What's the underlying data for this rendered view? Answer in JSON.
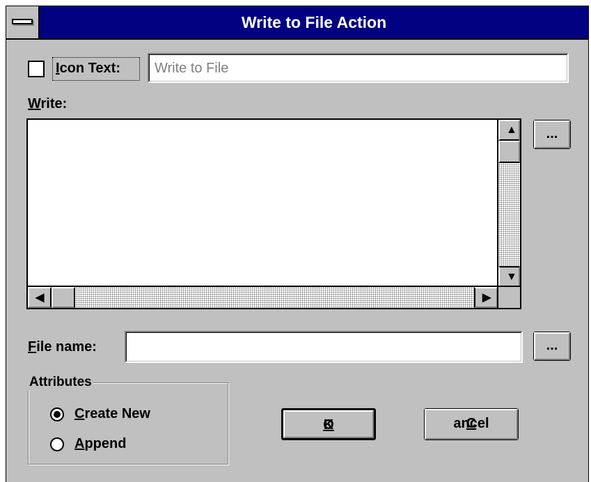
{
  "window": {
    "title": "Write to File Action"
  },
  "icon_text": {
    "label": "Icon Text:",
    "checked": false,
    "value": "Write to File"
  },
  "write": {
    "label": "Write:",
    "value": "",
    "browse_label": "..."
  },
  "file_name": {
    "label": "File name:",
    "value": "",
    "browse_label": "..."
  },
  "attributes": {
    "label": "Attributes",
    "options": [
      {
        "label": "Create New",
        "selected": true
      },
      {
        "label": "Append",
        "selected": false
      }
    ]
  },
  "buttons": {
    "ok": "OK",
    "cancel": "Cancel"
  },
  "icons": {
    "system_menu": "system-menu-icon",
    "scroll_up": "arrow-up-icon",
    "scroll_down": "arrow-down-icon",
    "scroll_left": "arrow-left-icon",
    "scroll_right": "arrow-right-icon"
  },
  "colors": {
    "titlebar": "#000080",
    "face": "#c0c0c0",
    "title_text": "#ffffff"
  }
}
